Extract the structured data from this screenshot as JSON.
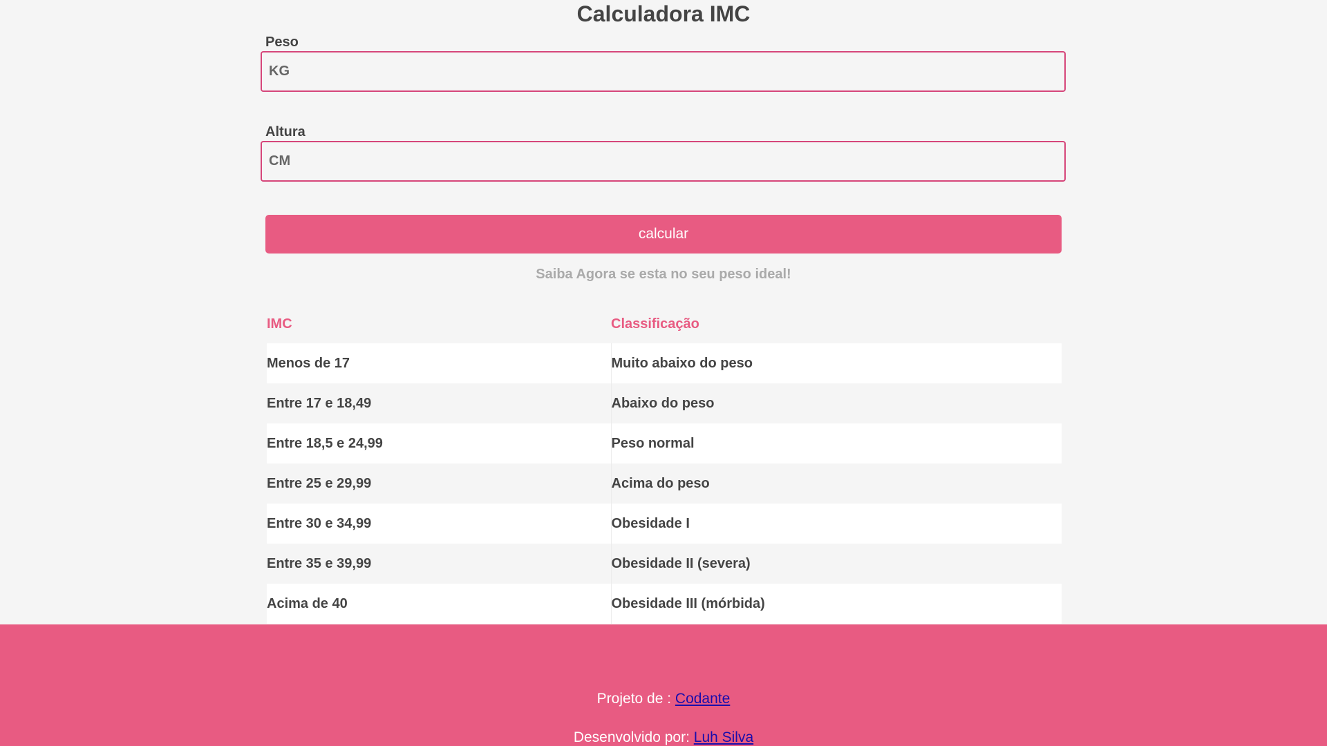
{
  "title": "Calculadora IMC",
  "form": {
    "peso_label": "Peso",
    "peso_placeholder": "KG",
    "altura_label": "Altura",
    "altura_placeholder": "CM",
    "button_label": "calcular"
  },
  "hint": "Saiba Agora se esta no seu peso ideal!",
  "table": {
    "headers": [
      "IMC",
      "Classificação"
    ],
    "rows": [
      [
        "Menos de 17",
        "Muito abaixo do peso"
      ],
      [
        "Entre 17 e 18,49",
        "Abaixo do peso"
      ],
      [
        "Entre 18,5 e 24,99",
        "Peso normal"
      ],
      [
        "Entre 25 e 29,99",
        "Acima do peso"
      ],
      [
        "Entre 30 e 34,99",
        "Obesidade I"
      ],
      [
        "Entre 35 e 39,99",
        "Obesidade II (severa)"
      ],
      [
        "Acima de 40",
        "Obesidade III (mórbida)"
      ]
    ]
  },
  "footer": {
    "project_prefix": "Projeto de : ",
    "project_link": "Codante",
    "dev_prefix": "Desenvolvido por: ",
    "dev_link": "Luh Silva"
  },
  "colors": {
    "accent": "#e85b82",
    "input_border": "#d6467a",
    "background": "#f5f5f5",
    "text": "#444444",
    "hint": "#aaaaaa",
    "link": "#1a0dab"
  }
}
